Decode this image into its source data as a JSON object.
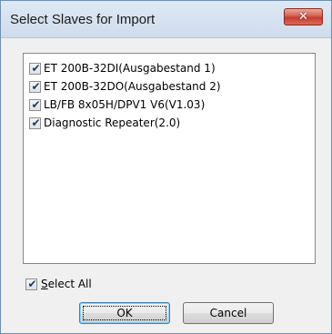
{
  "window": {
    "title": "Select Slaves for Import",
    "close_label": "✕"
  },
  "list": {
    "items": [
      {
        "label": "ET 200B-32DI(Ausgabestand 1)",
        "checked": true
      },
      {
        "label": "ET 200B-32DO(Ausgabestand 2)",
        "checked": true
      },
      {
        "label": "LB/FB 8x05H/DPV1 V6(V1.03)",
        "checked": true
      },
      {
        "label": "Diagnostic Repeater(2.0)",
        "checked": true
      }
    ]
  },
  "select_all": {
    "label_mnemonic": "S",
    "label_rest": "elect All",
    "checked": true
  },
  "buttons": {
    "ok_label": "OK",
    "cancel_label": "Cancel"
  },
  "check_glyph": "✔"
}
